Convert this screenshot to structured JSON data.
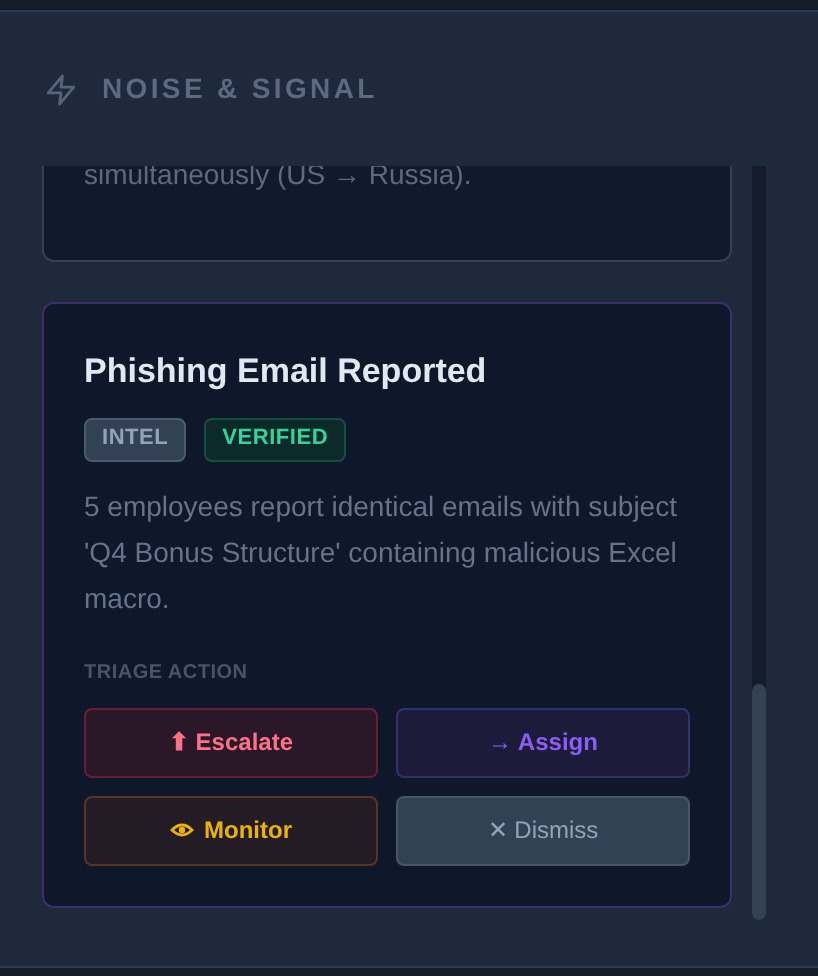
{
  "panel": {
    "title": "NOISE & SIGNAL"
  },
  "cards": [
    {
      "kind": "partial",
      "description": "simultaneously (US → Russia)."
    },
    {
      "kind": "full",
      "title": "Phishing Email Reported",
      "tags": [
        {
          "label": "INTEL",
          "kind": "category"
        },
        {
          "label": "VERIFIED",
          "kind": "verified"
        }
      ],
      "description": "5 employees report identical emails with subject 'Q4 Bonus Structure' containing malicious Excel macro.",
      "action_label": "TRIAGE ACTION",
      "actions": [
        {
          "kind": "escalate",
          "glyph": "⬆",
          "label": "Escalate"
        },
        {
          "kind": "assign",
          "glyph": "→",
          "label": "Assign"
        },
        {
          "kind": "monitor",
          "label": "Monitor"
        },
        {
          "kind": "dismiss",
          "glyph": "✕",
          "label": "Dismiss"
        }
      ]
    }
  ]
}
